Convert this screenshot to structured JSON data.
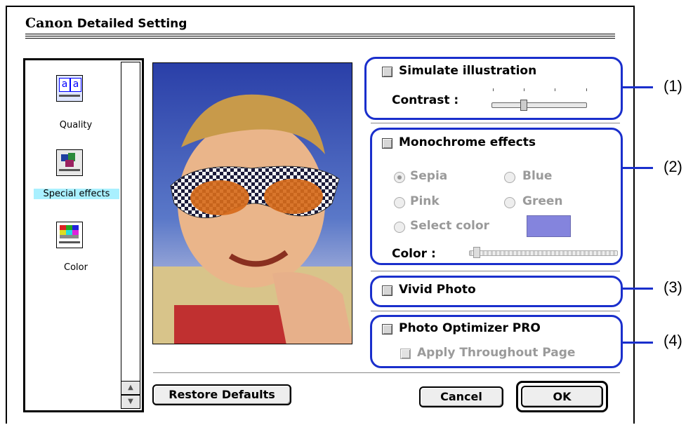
{
  "window": {
    "brand": "Canon",
    "title": "Detailed Setting"
  },
  "sidebar": {
    "items": [
      {
        "label": "Quality",
        "icon": "quality-icon"
      },
      {
        "label": "Special effects",
        "icon": "special-effects-icon",
        "selected": true
      },
      {
        "label": "Color",
        "icon": "color-icon"
      }
    ]
  },
  "simulate": {
    "label": "Simulate illustration",
    "contrast_label": "Contrast :",
    "contrast_value": 0.3
  },
  "monochrome": {
    "label": "Monochrome effects",
    "options": [
      "Sepia",
      "Blue",
      "Pink",
      "Green",
      "Select color"
    ],
    "selected": "Sepia",
    "color_label": "Color :",
    "swatch": "#8484dd"
  },
  "vivid": {
    "label": "Vivid Photo"
  },
  "optimizer": {
    "label": "Photo Optimizer PRO",
    "apply_label": "Apply Throughout Page"
  },
  "buttons": {
    "restore": "Restore Defaults",
    "cancel": "Cancel",
    "ok": "OK"
  },
  "callouts": [
    "(1)",
    "(2)",
    "(3)",
    "(4)"
  ],
  "colors": {
    "callout_blue": "#1a2fcc",
    "sidebar_highlight": "#a9f0ff"
  }
}
